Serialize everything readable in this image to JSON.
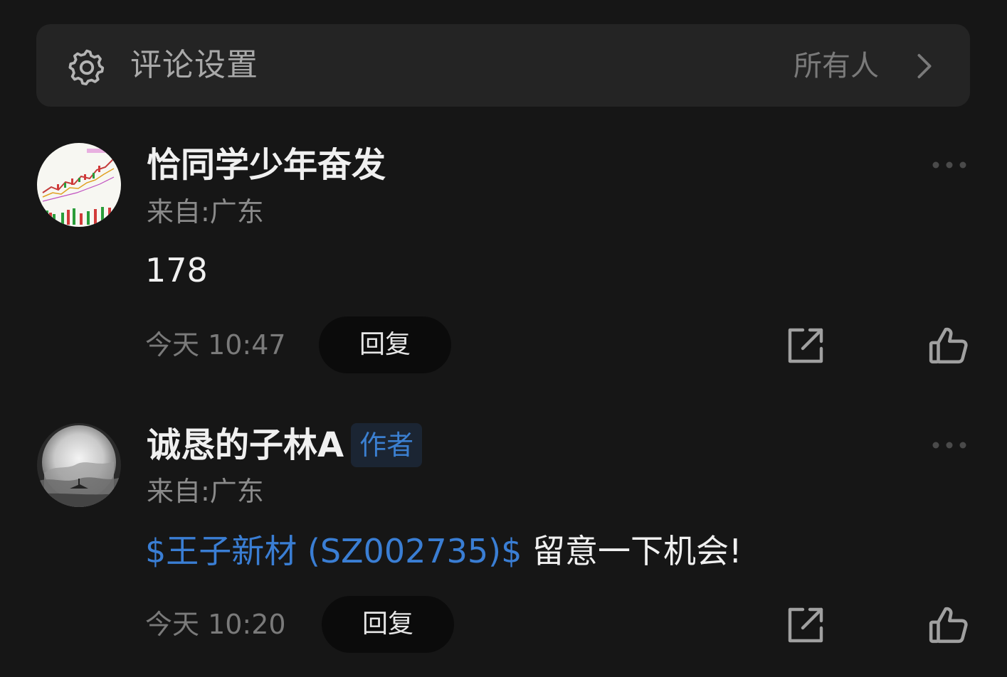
{
  "settings": {
    "title": "评论设置",
    "value": "所有人",
    "icon": "gear-icon",
    "chevron_icon": "chevron-right-icon"
  },
  "comments": [
    {
      "username": "恰同学少年奋发",
      "location": "来自:广东",
      "text": "178",
      "time": "今天 10:47",
      "reply_label": "回复",
      "avatar": "stock-chart-avatar"
    },
    {
      "username": "诚恳的子林A",
      "badge": "作者",
      "location": "来自:广东",
      "stock_link": "$王子新材 (SZ002735)$",
      "text": " 留意一下机会!",
      "time": "今天 10:20",
      "reply_label": "回复",
      "avatar": "moon-landscape-avatar"
    }
  ],
  "colors": {
    "background": "#161616",
    "panel": "#242424",
    "link": "#3a7ed4",
    "badge_bg": "#1b2533"
  }
}
